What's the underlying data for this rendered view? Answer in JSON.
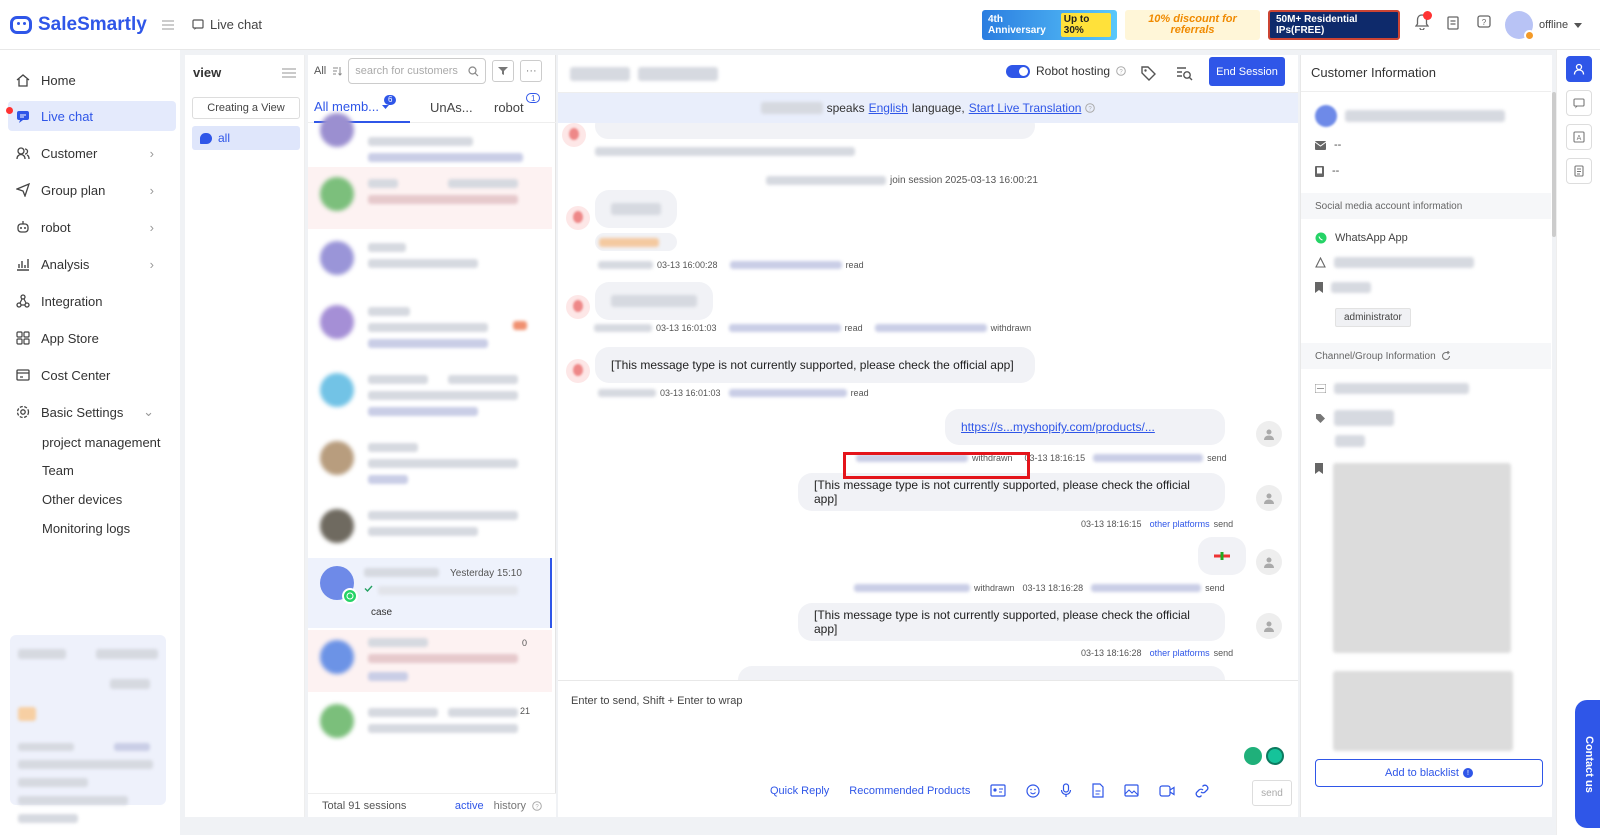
{
  "app": {
    "name": "SaleSmartly",
    "page_title": "Live chat"
  },
  "banners": {
    "anniversary": "4th Anniversary",
    "anniversary_deal": "Up to 30%",
    "referral": "10% discount for referrals",
    "ips": "50M+ Residential IPs(FREE)"
  },
  "user": {
    "status": "offline"
  },
  "nav": {
    "items": [
      {
        "label": "Home",
        "icon": "home-icon"
      },
      {
        "label": "Live chat",
        "icon": "chat-icon"
      },
      {
        "label": "Customer",
        "icon": "customer-icon"
      },
      {
        "label": "Group plan",
        "icon": "send-icon"
      },
      {
        "label": "robot",
        "icon": "robot-icon"
      },
      {
        "label": "Analysis",
        "icon": "analysis-icon"
      },
      {
        "label": "Integration",
        "icon": "integration-icon"
      },
      {
        "label": "App Store",
        "icon": "app-store-icon"
      },
      {
        "label": "Cost Center",
        "icon": "cost-icon"
      },
      {
        "label": "Basic Settings",
        "icon": "settings-icon"
      }
    ],
    "sub_items": [
      "project management",
      "Team",
      "Other devices",
      "Monitoring logs"
    ]
  },
  "views": {
    "title": "view",
    "create_label": "Creating a View",
    "all_label": "all"
  },
  "sessions": {
    "filter_all": "All",
    "search_placeholder": "search for customers",
    "tabs": [
      {
        "label": "All memb...",
        "badge": "6"
      },
      {
        "label": "UnAs..."
      },
      {
        "label": "robot",
        "badge": "1"
      }
    ],
    "selected_time": "Yesterday 15:10",
    "selected_snippet": "case",
    "partial_count": "0",
    "partial_count_2": "21",
    "total": "Total 91 sessions",
    "active_label": "active",
    "history_label": "history"
  },
  "chat": {
    "robot_hosting": "Robot hosting",
    "end_session": "End Session",
    "lang": {
      "speaks": "speaks",
      "language_name": "English",
      "language_word": "language,",
      "translate_link": "Start Live Translation"
    },
    "join_text": "join session 2025-03-13 16:00:21",
    "messages": [
      {
        "time": "03-13 16:00:28",
        "status": "read"
      },
      {
        "time": "03-13 16:01:03",
        "status": "read",
        "extra": "withdrawn"
      },
      {
        "text": "[This message type is not currently supported, please check the official app]",
        "time": "03-13 16:01:03",
        "status": "read"
      },
      {
        "text": "https://s...myshopify.com/products/...",
        "time": "03-13 18:16:15",
        "status": "send",
        "extra": "withdrawn"
      },
      {
        "text": "[This message type is not currently supported, please check the official app]",
        "time": "03-13 18:16:15",
        "platform": "other platforms",
        "status": "send"
      },
      {
        "time": "03-13 18:16:28",
        "status": "send",
        "extra": "withdrawn"
      },
      {
        "text": "[This message type is not currently supported, please check the official app]",
        "time": "03-13 18:16:28",
        "platform": "other platforms",
        "status": "send"
      }
    ],
    "input_hint": "Enter to send, Shift + Enter to wrap",
    "quick_reply": "Quick Reply",
    "recommended": "Recommended Products",
    "send": "send"
  },
  "customer": {
    "title": "Customer Information",
    "email": "--",
    "phone": "--",
    "social_header": "Social media account information",
    "channel_name": "WhatsApp App",
    "role": "administrator",
    "group_header": "Channel/Group Information",
    "blacklist": "Add to blacklist"
  },
  "contact_us": "Contact us"
}
